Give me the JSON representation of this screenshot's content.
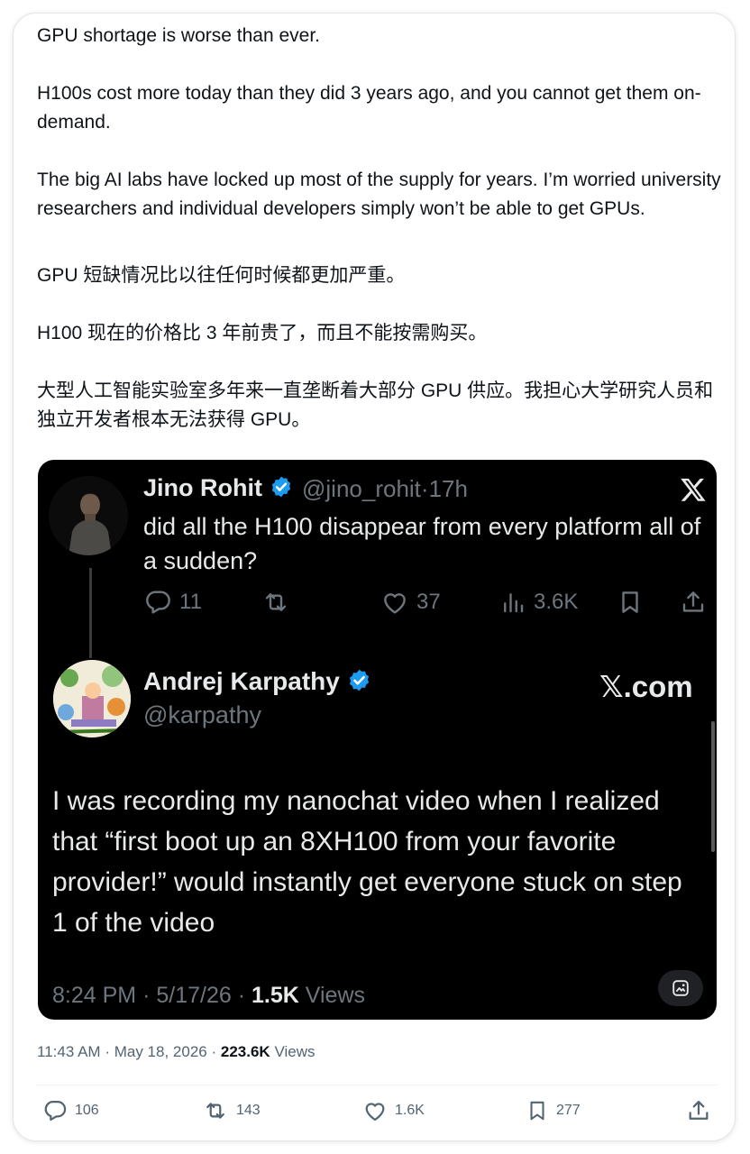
{
  "post": {
    "paragraphs_en": [
      "GPU shortage is worse than ever.",
      "H100s cost more today than they did 3 years ago, and you cannot get them on-demand.",
      "The big AI labs have locked up most of the supply for years. I’m worried university researchers and individual developers simply won’t be able to get GPUs."
    ],
    "paragraphs_zh": [
      "GPU 短缺情况比以往任何时候都更加严重。",
      "H100 现在的价格比 3 年前贵了，而且不能按需购买。",
      "大型人工智能实验室多年来一直垄断着大部分 GPU 供应。我担心大学研究人员和独立开发者根本无法获得 GPU。"
    ],
    "time": "11:43 AM",
    "date": "May 18, 2026",
    "views_count": "223.6K",
    "views_label": "Views",
    "sep": "·",
    "actions": {
      "replies": "106",
      "reposts": "143",
      "likes": "1.6K",
      "bookmarks": "277"
    }
  },
  "quote": {
    "first_tweet": {
      "name": "Jino Rohit",
      "handle": "@jino_rohit",
      "age": "17h",
      "text": "did all the H100 disappear from every platform all of a sudden?",
      "replies": "11",
      "likes": "37",
      "views": "3.6K"
    },
    "second_tweet": {
      "name": "Andrej Karpathy",
      "handle": "@karpathy",
      "brand": "𝕏.com",
      "text": "I was recording my nanochat video when I realized that “first boot up an 8XH100 from your favorite provider!” would instantly get everyone stuck on step 1 of the video",
      "time": "8:24 PM",
      "date": "5/17/26",
      "views_count": "1.5K",
      "views_label": "Views"
    }
  },
  "colors": {
    "verified": "#1d9bf0",
    "text_dark": "#0f1419",
    "muted": "#536471",
    "quote_bg": "#000000"
  },
  "icons": [
    "x-logo-icon",
    "verified-badge-icon",
    "reply-icon",
    "repost-icon",
    "like-icon",
    "views-icon",
    "bookmark-icon",
    "share-icon",
    "edit-image-icon"
  ]
}
